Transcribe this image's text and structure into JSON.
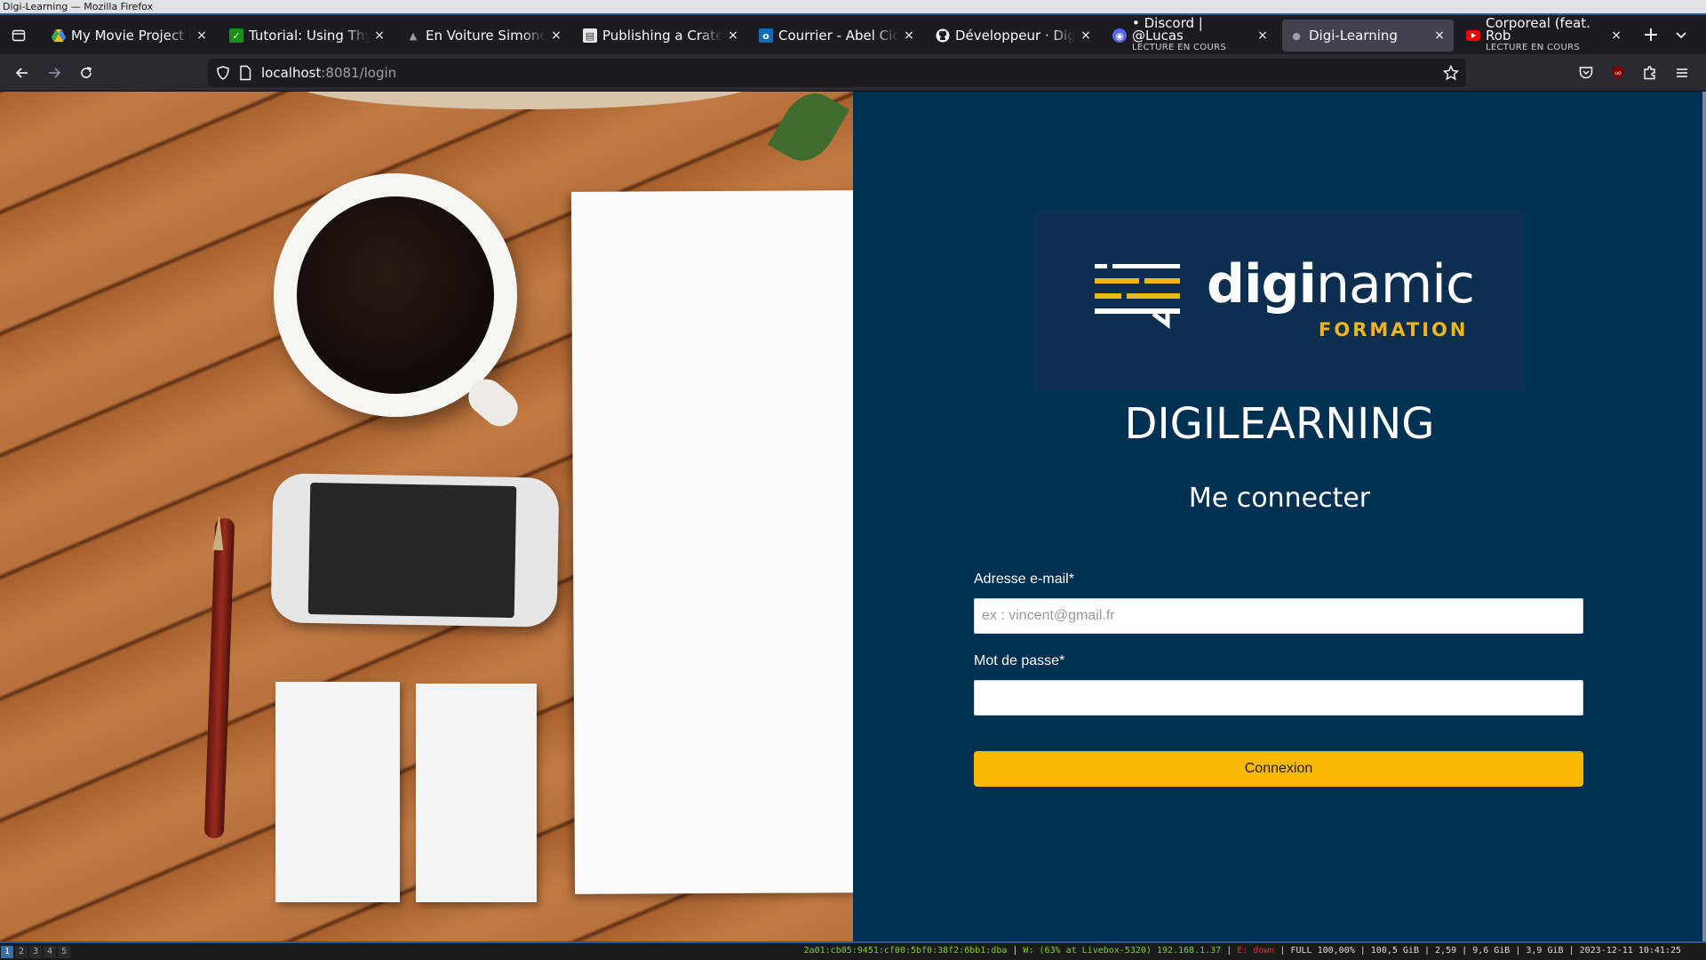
{
  "window": {
    "title": "Digi-Learning — Mozilla Firefox"
  },
  "tabs": [
    {
      "title": "My Movie Project [VO",
      "favicon": "google-drive-icon",
      "color": "#34a853"
    },
    {
      "title": "Tutorial: Using Thymeleaf",
      "favicon": "check-icon",
      "color": "#1a8f1a"
    },
    {
      "title": "En Voiture Simone",
      "favicon": "car-icon",
      "color": "#5a5a5a"
    },
    {
      "title": "Publishing a Crate to",
      "favicon": "book-icon",
      "color": "#e8e8e8"
    },
    {
      "title": "Courrier - Abel Ciccoli",
      "favicon": "outlook-icon",
      "color": "#0f6cbd"
    },
    {
      "title": "Développeur · DigiSu",
      "favicon": "github-icon",
      "color": "#ffffff"
    },
    {
      "title": "• Discord | @Lucas",
      "subtitle": "LECTURE EN COURS",
      "favicon": "discord-icon",
      "color": "#5865f2"
    },
    {
      "title": "Digi-Learning",
      "favicon": "globe-icon",
      "color": "#9aa0a6",
      "active": true
    },
    {
      "title": "Corporeal (feat. Rob",
      "subtitle": "LECTURE EN COURS",
      "favicon": "youtube-icon",
      "color": "#ff0000"
    }
  ],
  "navbar": {
    "url_host": "localhost",
    "url_rest": ":8081/login"
  },
  "panel": {
    "logo_word_bold": "digi",
    "logo_word_light": "namic",
    "logo_sub": "FORMATION",
    "app_title": "DIGILEARNING",
    "subtitle": "Me connecter",
    "email_label": "Adresse e-mail*",
    "email_placeholder": "ex : vincent@gmail.fr",
    "email_value": "",
    "password_label": "Mot de passe*",
    "password_value": "",
    "submit_label": "Connexion",
    "colors": {
      "background": "#003052",
      "accent": "#f9b901"
    }
  },
  "statusbar": {
    "workspaces": [
      "1",
      "2",
      "3",
      "4",
      "5"
    ],
    "active_workspace": "1",
    "ipv6": "2a01:cb05:9451:cf00:5bf0:38f2:6bb1:dba",
    "wifi": "W: (63% at Livebox-5320) 192.168.1.37",
    "eth": "E: down",
    "battery": "FULL 100,00%",
    "disk": "100,5 GiB",
    "load": "2,59",
    "memory": "9,6 GiB | 3,9 GiB",
    "datetime": "2023-12-11 10:41:25"
  }
}
